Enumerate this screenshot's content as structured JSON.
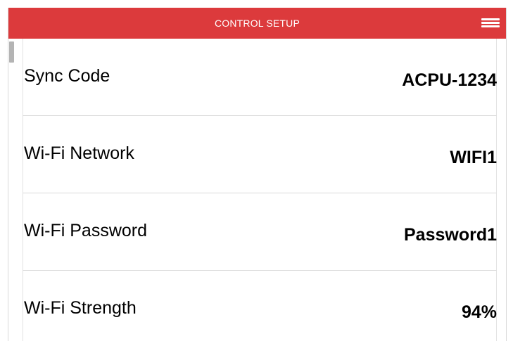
{
  "header": {
    "title": "CONTROL SETUP",
    "menu_icon": "hamburger-menu-icon",
    "background_color": "#dc3a3c"
  },
  "settings": [
    {
      "label": "Sync Code",
      "value": "ACPU-1234"
    },
    {
      "label": "Wi-Fi Network",
      "value": "WIFI1"
    },
    {
      "label": "Wi-Fi Password",
      "value": "Password1"
    },
    {
      "label": "Wi-Fi Strength",
      "value": "94%"
    }
  ]
}
